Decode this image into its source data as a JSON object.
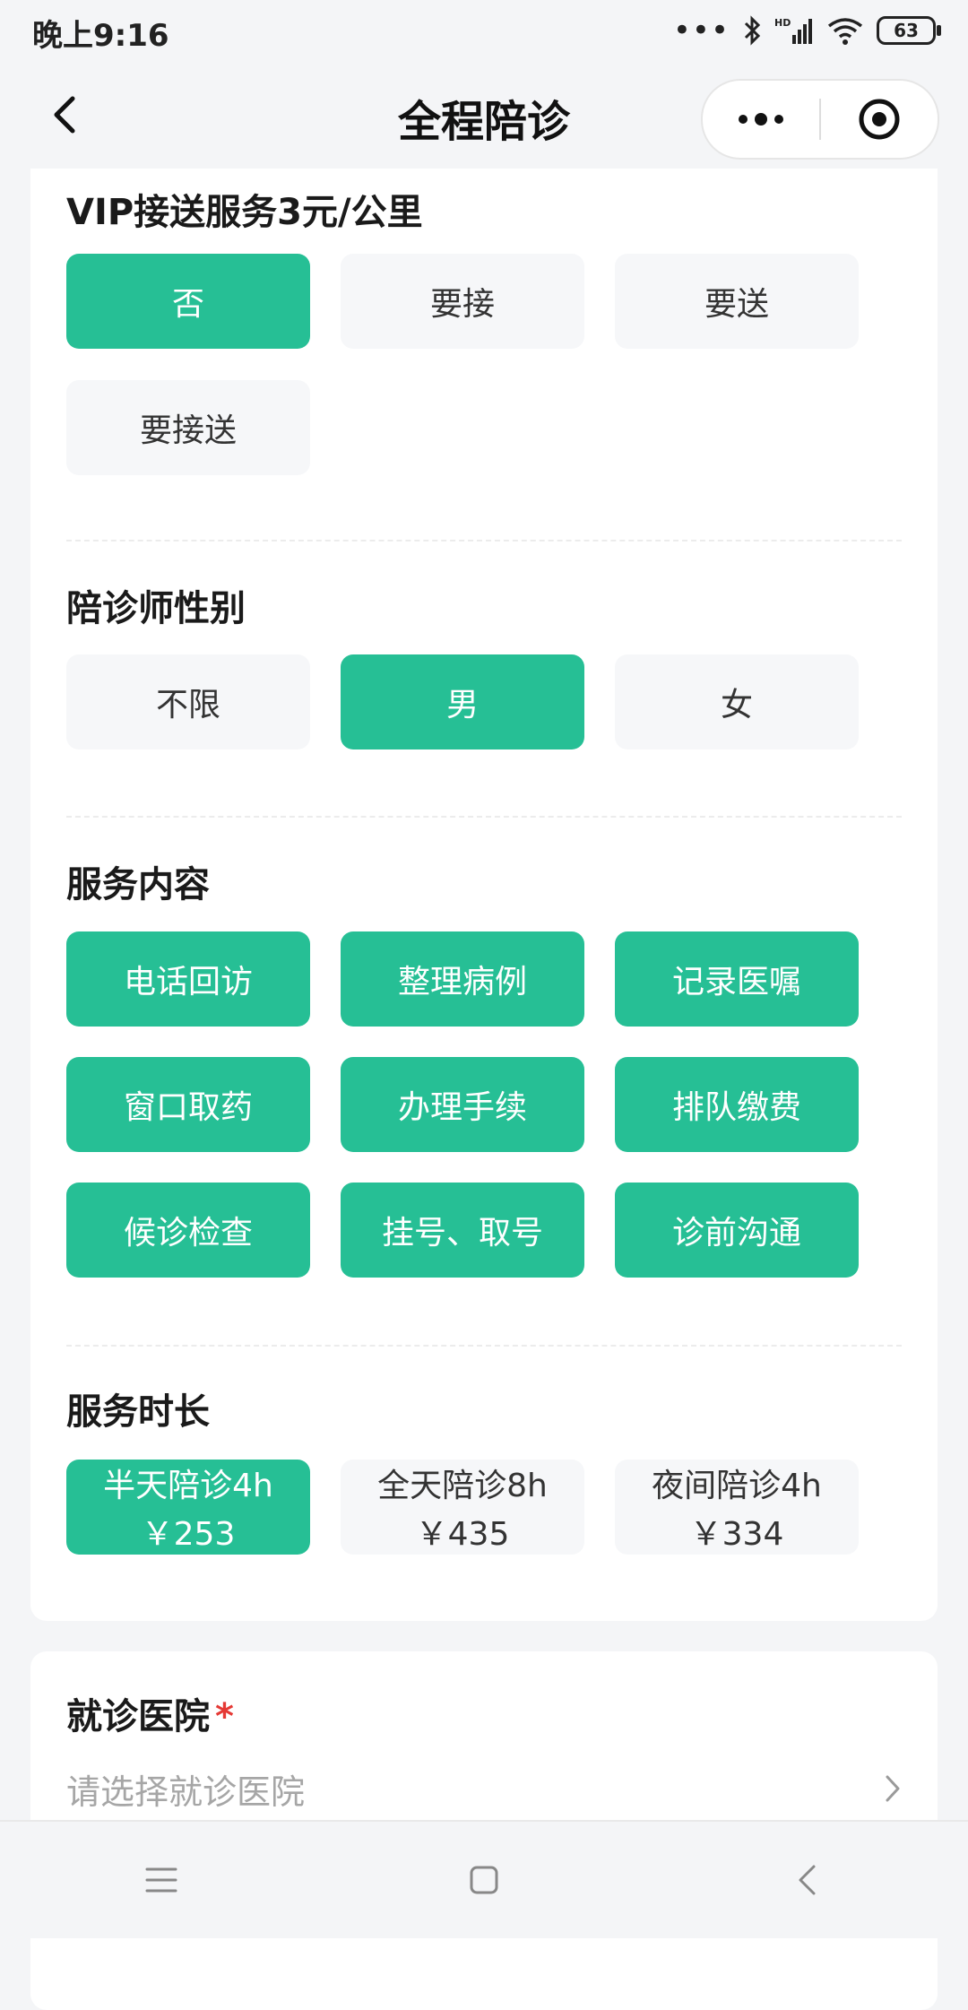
{
  "status_bar": {
    "time": "晚上9:16",
    "battery": "63",
    "icons": [
      "signal-dots-icon",
      "bluetooth-icon",
      "hd-signal-icon",
      "wifi-icon",
      "battery-icon"
    ]
  },
  "nav": {
    "title": "全程陪诊",
    "back_icon": "chevron-left-icon",
    "more_icon": "more-dots-icon",
    "close_icon": "target-close-icon"
  },
  "colors": {
    "accent": "#26bf95",
    "option_bg": "#f6f7f9",
    "required": "#e53935"
  },
  "vip": {
    "title": "VIP接送服务3元/公里",
    "options": [
      {
        "label": "否",
        "selected": true
      },
      {
        "label": "要接",
        "selected": false
      },
      {
        "label": "要送",
        "selected": false
      },
      {
        "label": "要接送",
        "selected": false
      }
    ]
  },
  "gender": {
    "title": "陪诊师性别",
    "options": [
      {
        "label": "不限",
        "selected": false
      },
      {
        "label": "男",
        "selected": true
      },
      {
        "label": "女",
        "selected": false
      }
    ]
  },
  "content": {
    "title": "服务内容",
    "options": [
      {
        "label": "电话回访",
        "selected": true
      },
      {
        "label": "整理病例",
        "selected": true
      },
      {
        "label": "记录医嘱",
        "selected": true
      },
      {
        "label": "窗口取药",
        "selected": true
      },
      {
        "label": "办理手续",
        "selected": true
      },
      {
        "label": "排队缴费",
        "selected": true
      },
      {
        "label": "候诊检查",
        "selected": true
      },
      {
        "label": "挂号、取号",
        "selected": true
      },
      {
        "label": "诊前沟通",
        "selected": true
      }
    ]
  },
  "duration": {
    "title": "服务时长",
    "options": [
      {
        "label": "半天陪诊4h",
        "price": "￥253",
        "selected": true
      },
      {
        "label": "全天陪诊8h",
        "price": "￥435",
        "selected": false
      },
      {
        "label": "夜间陪诊4h",
        "price": "￥334",
        "selected": false
      }
    ]
  },
  "hospital": {
    "title": "就诊医院",
    "required_mark": "*",
    "placeholder": "请选择就诊医院",
    "chevron_icon": "chevron-right-icon"
  },
  "system_nav": {
    "menu_icon": "menu-icon",
    "home_icon": "home-square-icon",
    "back_icon": "back-triangle-icon"
  }
}
